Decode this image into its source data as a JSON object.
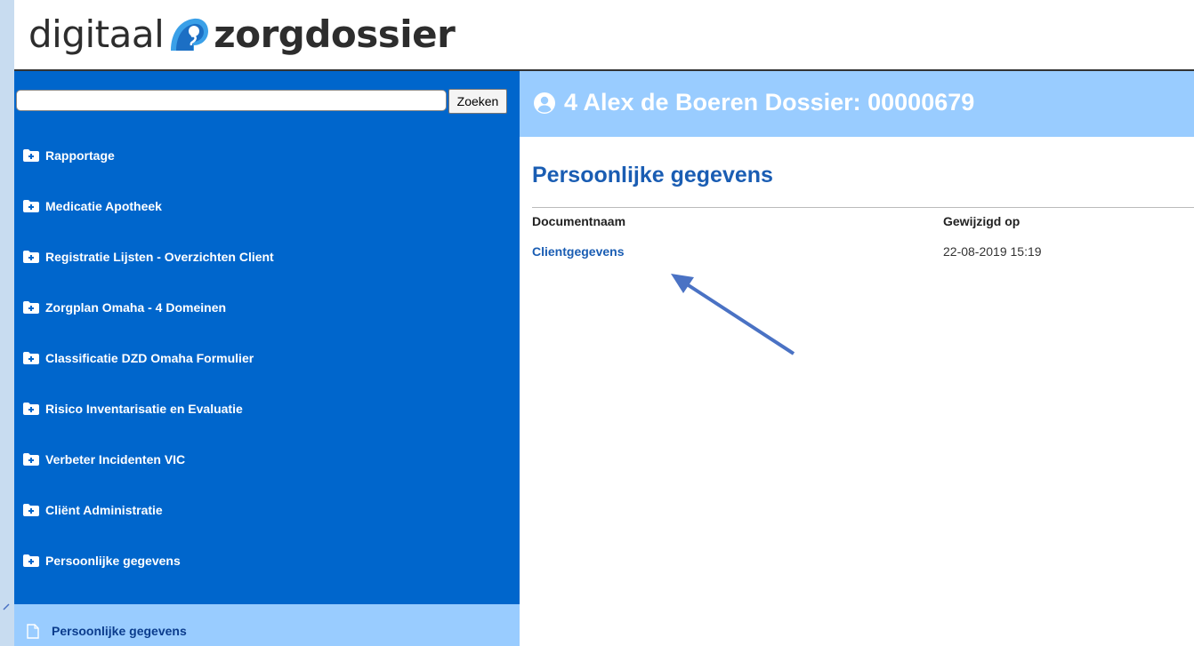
{
  "brand": {
    "logo_text_1": "digitaal",
    "logo_text_2": "zorgdossier",
    "logo_colors": [
      "#3aa0e8",
      "#1c6fc4"
    ]
  },
  "search": {
    "value": "",
    "placeholder": "",
    "button_label": "Zoeken"
  },
  "header": {
    "title": "4 Alex de Boeren Dossier: 00000679",
    "icon": "user-circle-icon"
  },
  "sidebar": {
    "items": [
      {
        "label": "Rapportage",
        "icon": "folder-plus-icon"
      },
      {
        "label": "Medicatie Apotheek",
        "icon": "folder-plus-icon"
      },
      {
        "label": "Registratie Lijsten - Overzichten Client",
        "icon": "folder-plus-icon"
      },
      {
        "label": "Zorgplan Omaha - 4 Domeinen",
        "icon": "folder-plus-icon"
      },
      {
        "label": "Classificatie DZD Omaha Formulier",
        "icon": "folder-plus-icon"
      },
      {
        "label": "Risico Inventarisatie en Evaluatie",
        "icon": "folder-plus-icon"
      },
      {
        "label": "Verbeter Incidenten VIC",
        "icon": "folder-plus-icon"
      },
      {
        "label": "Cliënt Administratie",
        "icon": "folder-plus-icon"
      },
      {
        "label": "Persoonlijke gegevens",
        "icon": "folder-plus-icon"
      }
    ],
    "active_subitem": {
      "label": "Persoonlijke gegevens",
      "icon": "document-icon"
    }
  },
  "main": {
    "heading": "Persoonlijke gegevens",
    "table": {
      "columns": [
        "Documentnaam",
        "Gewijzigd op"
      ],
      "rows": [
        {
          "name": "Clientgegevens",
          "modified": "22-08-2019 15:19"
        }
      ]
    }
  },
  "colors": {
    "sidebar_bg": "#0066cc",
    "header_bar_bg": "#99ccff",
    "link": "#1a5db3",
    "arrow": "#4a72c4"
  }
}
